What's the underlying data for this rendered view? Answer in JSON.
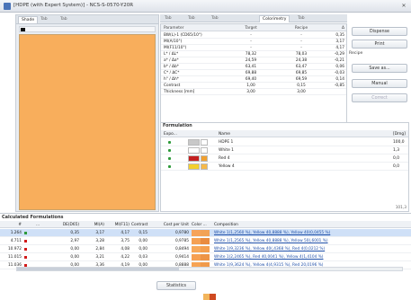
{
  "window": {
    "title": "[HDPE (with Expert System)] - NCS-S-0570-Y20R"
  },
  "left_tabs": [
    "Shade",
    "Tab",
    "Tab"
  ],
  "right_tabs": [
    "Tab",
    "Tab",
    "Tab",
    "Colorimetry",
    "Tab"
  ],
  "param_table": {
    "headers": [
      "Parameter",
      "Target",
      "Recipe",
      "Δ"
    ],
    "rows": [
      {
        "param": "BW(L)-1 (CD65/10°)",
        "target": "-",
        "recipe": "-",
        "delta": "0,35"
      },
      {
        "param": "MI(A/10°)",
        "target": "-",
        "recipe": "-",
        "delta": "3,17"
      },
      {
        "param": "MI(F11/10°)",
        "target": "-",
        "recipe": "-",
        "delta": "4,17"
      },
      {
        "param": "L* / ΔL*",
        "target": "78,32",
        "recipe": "78,03",
        "delta": "-0,29"
      },
      {
        "param": "a* / Δa*",
        "target": "24,59",
        "recipe": "24,38",
        "delta": "-0,21"
      },
      {
        "param": "b* / Δb*",
        "target": "63,41",
        "recipe": "63,47",
        "delta": "0,06"
      },
      {
        "param": "C* / ΔC*",
        "target": "69,88",
        "recipe": "69,85",
        "delta": "-0,03"
      },
      {
        "param": "h° / Δh*",
        "target": "69,40",
        "recipe": "69,59",
        "delta": "0,14"
      },
      {
        "param": "Contrast",
        "target": "1,00",
        "recipe": "0,15",
        "delta": "-0,85"
      },
      {
        "param": "Thickness [mm]",
        "target": "3,00",
        "recipe": "3,00",
        "delta": ""
      }
    ]
  },
  "buttons": {
    "dispense": "Dispense",
    "print": "Print",
    "recipe_label": "Recipe",
    "save_as": "Save as...",
    "manual": "Manual",
    "correct": "Correct"
  },
  "formulation": {
    "title": "Formulation",
    "headers": [
      "Expo...",
      "Name",
      "[Dmg]"
    ],
    "rows": [
      {
        "name": "HDPE 1",
        "amount": "100,0",
        "sw1": "#c8c8c8",
        "sw2": "#ffffff"
      },
      {
        "name": "White 1",
        "amount": "1,3",
        "sw1": "#ffffff",
        "sw2": "#ffffff"
      },
      {
        "name": "Red 4",
        "amount": "0,0",
        "sw1": "#c41f1f",
        "sw2": "#f0a030"
      },
      {
        "name": "Yellow 4",
        "amount": "0,0",
        "sw1": "#f3cf2e",
        "sw2": "#f6b94a"
      }
    ],
    "footer": "101,3"
  },
  "calc": {
    "title": "Calculated Formulations",
    "headers": {
      "idx": "#",
      "dots": "...",
      "de": "DE(D65)",
      "mi": "MI(A)",
      "mi2": "MI(F11)",
      "contrast": "Contrast",
      "cost": "Cost per Unit",
      "color": "Color ...",
      "composition": "Composition"
    },
    "rows": [
      {
        "idx": "1.264",
        "mark": "#2e9a3a",
        "de": "0,35",
        "mi": "3,17",
        "mi2": "4,17",
        "ct": "0,15",
        "cost": "0,9780",
        "ca": "#f6a35a",
        "cb": "#f2a256",
        "comp": "White 1(1,2560 %), Yellow 40,8888 %), Yellow 40(0,0455 %)",
        "selected": true
      },
      {
        "idx": "4.711",
        "mark": "#d21a1a",
        "de": "2,97",
        "mi": "3,28",
        "mi2": "3,75",
        "ct": "0,00",
        "cost": "0,9785",
        "ca": "#f5a153",
        "cb": "#e98b3f",
        "comp": "White 1(1,2565 %), Yellow 40,8888 %), Yellow 50(,6001 %)",
        "selected": false
      },
      {
        "idx": "10.972",
        "mark": "#d21a1a",
        "de": "0,00",
        "mi": "2,84",
        "mi2": "4,08",
        "ct": "0,00",
        "cost": "0,8494",
        "ca": "#f7a95a",
        "cb": "#f49f4f",
        "comp": "White 1(9,3236 %), Yellow 40(,4368 %), Red 4(0,0212 %)",
        "selected": false
      },
      {
        "idx": "11.015",
        "mark": "#d21a1a",
        "de": "0,00",
        "mi": "3,21",
        "mi2": "4,22",
        "ct": "0,03",
        "cost": "0,9414",
        "ca": "#f6a052",
        "cb": "#ed9446",
        "comp": "White 1(2,2465 %), Red 40,0041 %), Yellow 4(1,4104 %)",
        "selected": false
      },
      {
        "idx": "11.036",
        "mark": "#d21a1a",
        "de": "0,00",
        "mi": "3,36",
        "mi2": "4,19",
        "ct": "0,00",
        "cost": "0,8888",
        "ca": "#f6a354",
        "cb": "#f09a4a",
        "comp": "White 1(9,3624 %), Yellow 4(4,9315 %), Red 20,0196 %)",
        "selected": false
      }
    ]
  },
  "statistics_button": "Statistics",
  "colors": {
    "preview": "#f8ae5c",
    "accent": "#1f4fa8",
    "selected_row": "#cfe0f7"
  },
  "bottom_strip": [
    "#f2b55c",
    "#cf4a20"
  ]
}
